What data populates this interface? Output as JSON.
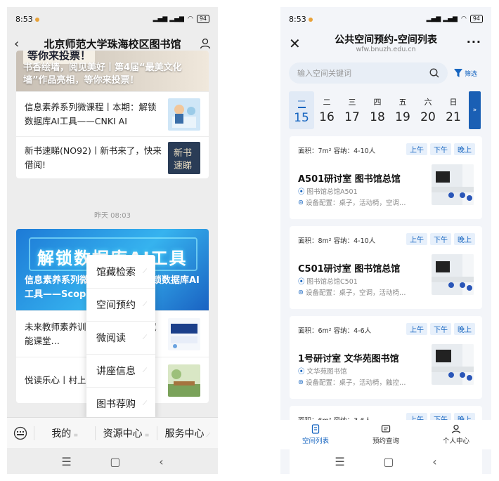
{
  "left": {
    "status": {
      "time": "8:53",
      "battery": "94"
    },
    "header": {
      "title": "北京师范大学珠海校区图书馆"
    },
    "banner1": {
      "stamp": "等你来投票！",
      "caption": "书香绘墙，阅见美好丨第4届“最美文化墙”作品亮相，等你来投票！"
    },
    "news1": [
      {
        "text": "信息素养系列微课程丨本期：解锁数据库AI工具——CNKI AI"
      },
      {
        "text": "新书速睇(NO92)丨新书来了，快来借阅!"
      }
    ],
    "time_separator": "昨天 08:03",
    "banner2": {
      "big": "解锁数据库AI工具",
      "caption": "信息素养系列微课程丨本期：解锁数据库AI工具——Scopus AI"
    },
    "news2": [
      {
        "text": "未来教师素养训练营丨人工智能赋能课堂…"
      },
      {
        "text": "悦读乐心丨村上…"
      }
    ],
    "popup_menu": [
      "馆藏检索",
      "空间预约",
      "微阅读",
      "讲座信息",
      "图书荐购"
    ],
    "tabs": [
      "我的",
      "资源中心",
      "服务中心"
    ]
  },
  "right": {
    "status": {
      "time": "8:53",
      "battery": "94"
    },
    "header": {
      "title": "公共空间预约-空间列表",
      "subtitle": "wfw.bnuzh.edu.cn"
    },
    "search": {
      "placeholder": "输入空间关键词",
      "filter_label": "筛选"
    },
    "week": [
      {
        "weekday": "一",
        "date": "15",
        "selected": true
      },
      {
        "weekday": "二",
        "date": "16"
      },
      {
        "weekday": "三",
        "date": "17"
      },
      {
        "weekday": "四",
        "date": "18"
      },
      {
        "weekday": "五",
        "date": "19"
      },
      {
        "weekday": "六",
        "date": "20"
      },
      {
        "weekday": "日",
        "date": "21"
      }
    ],
    "slots": [
      "上午",
      "下午",
      "晚上"
    ],
    "rooms": [
      {
        "meta": "面积：7m²  容纳：4-10人",
        "name": "A501研讨室  图书馆总馆",
        "location": "图书馆总馆A501",
        "equipment": "设备配置：桌子，活动椅，空调…"
      },
      {
        "meta": "面积：8m²  容纳：4-10人",
        "name": "C501研讨室  图书馆总馆",
        "location": "图书馆总馆C501",
        "equipment": "设备配置：桌子，空调，活动椅…"
      },
      {
        "meta": "面积：6m²  容纳：4-6人",
        "name": "1号研讨室  文华苑图书馆",
        "location": "文华苑图书馆",
        "equipment": "设备配置：桌子，活动椅，触控…"
      },
      {
        "meta": "面积：6m²  容纳：3-6人"
      }
    ],
    "tabs": [
      "空间列表",
      "预约查询",
      "个人中心"
    ],
    "accent": "#1665c0"
  }
}
